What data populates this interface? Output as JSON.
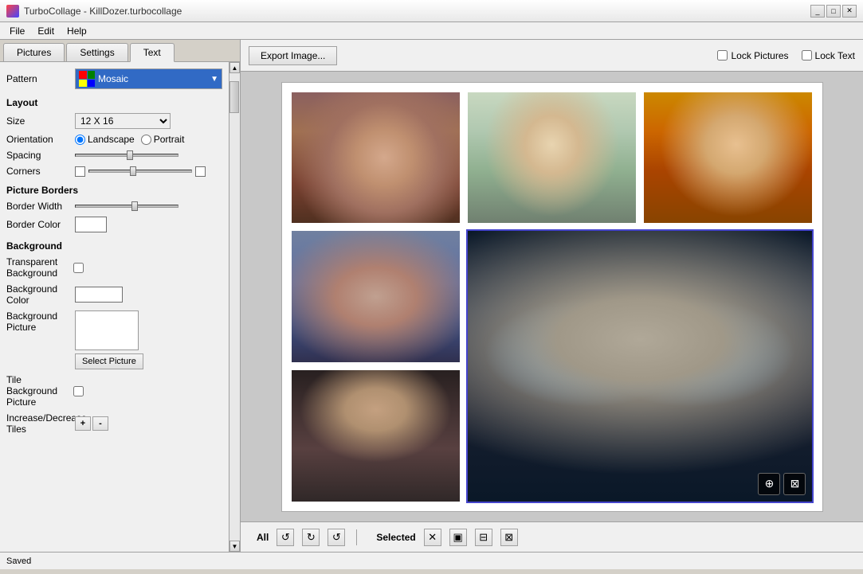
{
  "window": {
    "title": "TurboCollage - KillDozer.turbocollage",
    "title_short": "TurboCollage - KillDozer.turbocollage"
  },
  "menu": {
    "items": [
      "File",
      "Edit",
      "Help"
    ]
  },
  "tabs": {
    "items": [
      "Pictures",
      "Settings",
      "Text"
    ],
    "active": "Text"
  },
  "pattern": {
    "label": "Pattern",
    "value": "Mosaic",
    "dropdown_arrow": "▼"
  },
  "layout": {
    "title": "Layout",
    "size_label": "Size",
    "size_value": "12 X 16",
    "orientation_label": "Orientation",
    "orientation_landscape": "Landscape",
    "orientation_portrait": "Portrait",
    "spacing_label": "Spacing",
    "corners_label": "Corners"
  },
  "picture_borders": {
    "title": "Picture Borders",
    "border_width_label": "Border Width",
    "border_color_label": "Border Color"
  },
  "background": {
    "title": "Background",
    "transparent_label": "Transparent Background",
    "bg_color_label": "Background Color",
    "bg_picture_label": "Background Picture",
    "select_picture_btn": "Select Picture",
    "tile_bg_label": "Tile Background Picture",
    "increase_decrease_label": "Increase/Decrease Tiles",
    "inc_btn": "+",
    "dec_btn": "-"
  },
  "toolbar": {
    "export_btn": "Export Image...",
    "lock_pictures_label": "Lock Pictures",
    "lock_text_label": "Lock Text"
  },
  "bottom_bar": {
    "all_label": "All",
    "selected_label": "Selected"
  },
  "status": {
    "text": "Saved"
  },
  "title_buttons": {
    "minimize": "_",
    "maximize": "□",
    "close": "✕"
  }
}
